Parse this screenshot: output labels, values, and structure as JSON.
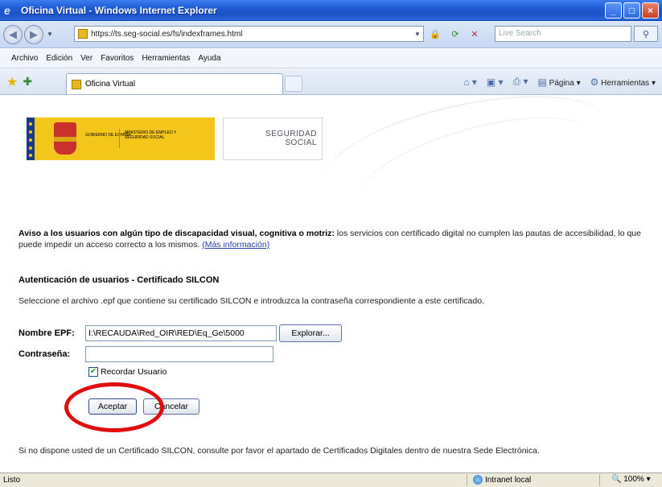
{
  "window": {
    "title": "Oficina Virtual - Windows Internet Explorer",
    "min_glyph": "_",
    "max_glyph": "□",
    "close_glyph": "×"
  },
  "address_bar": {
    "url": "https://ts.seg-social.es/fs/indexframes.html",
    "search_placeholder": "Live Search"
  },
  "menu": [
    "Archivo",
    "Edición",
    "Ver",
    "Favoritos",
    "Herramientas",
    "Ayuda"
  ],
  "tab": {
    "label": "Oficina Virtual"
  },
  "command_bar": {
    "page_label": "Página",
    "tools_label": "Herramientas"
  },
  "logos": {
    "gov_left": "GOBIERNO DE ESPAÑA",
    "gov_right": "MINISTERIO DE EMPLEO Y SEGURIDAD SOCIAL",
    "ss_line1": "SEGURIDAD",
    "ss_line2": "SOCIAL"
  },
  "notice": {
    "bold": "Aviso a los usuarios con algún tipo de discapacidad visual, cognitiva o motriz:",
    "text": " los servicios con certificado digital no cumplen las pautas de accesibilidad, lo que puede impedir un acceso correcto a los mismos.",
    "link": "(Más información)"
  },
  "auth": {
    "title": "Autenticación de usuarios - Certificado SILCON",
    "instructions": "Seleccione el archivo .epf que contiene su certificado SILCON e introduzca la contraseña correspondiente a este certificado.",
    "epf_label": "Nombre EPF:",
    "epf_value": "I:\\RECAUDA\\Red_OIR\\RED\\Eq_Ge\\5000",
    "browse_label": "Explorar...",
    "password_label": "Contraseña:",
    "password_value": "",
    "remember_label": "Recordar Usuario",
    "remember_checked": true,
    "accept_label": "Aceptar",
    "cancel_label": "Cancelar"
  },
  "footer": {
    "text": "Si no dispone usted de un Certificado SILCON, consulte por favor el apartado de Certificados Digitales dentro de nuestra Sede Electrónica."
  },
  "status_bar": {
    "status": "Listo",
    "zone": "Intranet local",
    "zoom": "100%"
  },
  "colors": {
    "titlebar": "#1e5bd6",
    "gov_logo": "#f4c61b",
    "highlight_circle": "#e10d0d",
    "link": "#2a3faa"
  }
}
